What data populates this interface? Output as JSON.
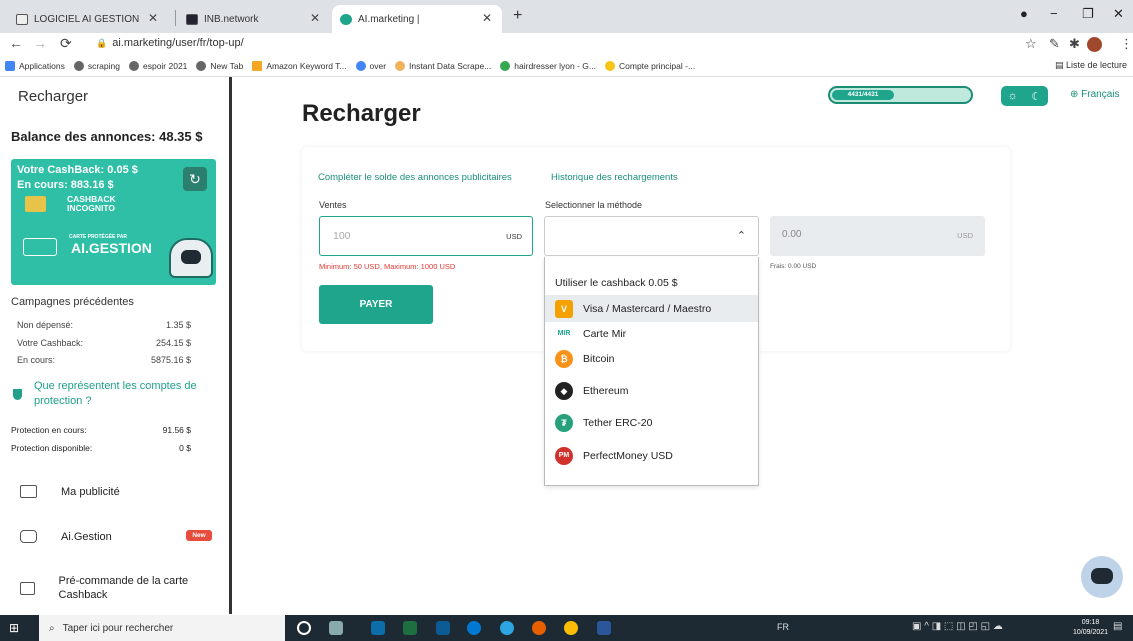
{
  "browser": {
    "tabs": [
      {
        "title": "LOGICIEL AI GESTION",
        "active": false
      },
      {
        "title": "INB.network",
        "active": false
      },
      {
        "title": "AI.marketing |",
        "active": true
      }
    ],
    "url": "ai.marketing/user/fr/top-up/",
    "bookmarks": [
      "Applications",
      "scraping",
      "espoir 2021",
      "New Tab",
      "Amazon Keyword T...",
      "over",
      "Instant Data Scrape...",
      "hairdresser lyon - G...",
      "Compte principal -..."
    ],
    "reading_list": "Liste de lecture"
  },
  "sidebar": {
    "title": "Recharger",
    "balance": "Balance des annonces: 48.35 $",
    "card": {
      "cashback": "Votre CashBack: 0.05 $",
      "en_cours": "En cours: 883.16 $",
      "incognito": "CASHBACK\nINCOGNITO",
      "protected_small": "CARTE PROTÉGÉE PAR",
      "protected_brand": "AI.GESTION"
    },
    "prev_campaigns_title": "Campagnes précédentes",
    "stats": [
      {
        "label": "Non dépensé:",
        "value": "1.35 $"
      },
      {
        "label": "Votre Cashback:",
        "value": "254.15 $"
      },
      {
        "label": "En cours:",
        "value": "5875.16 $"
      }
    ],
    "protection_question": "Que représentent les comptes de protection ?",
    "protection": [
      {
        "label": "Protection en cours:",
        "value": "91.56 $"
      },
      {
        "label": "Protection disponible:",
        "value": "0 $"
      }
    ],
    "menu": [
      {
        "label": "Ma publicité"
      },
      {
        "label": "Ai.Gestion",
        "badge": "New"
      },
      {
        "label": "Pré-commande de la carte Cashback"
      }
    ]
  },
  "main": {
    "title": "Recharger",
    "progress": {
      "label": "4431/4431",
      "fraction": 0.43
    },
    "language": "Français",
    "tabs": [
      "Compléter le solde des annonces publicitaires",
      "Historique des rechargements"
    ],
    "ventes_label": "Ventes",
    "amount_placeholder": "100",
    "currency": "USD",
    "minmax": "Minimum: 50 USD, Maximum: 1000 USD",
    "pay_button": "PAYER",
    "method_label": "Selectionner la méthode",
    "computed_amount": "0.00",
    "fees": "Frais: 0.00 USD",
    "dropdown": {
      "header": "Utiliser le cashback 0.05 $",
      "options": [
        {
          "label": "Visa / Mastercard / Maestro",
          "icon": "card-icon",
          "color": "#f4a100",
          "selected": true
        },
        {
          "label": "Carte Mir",
          "icon": "mir-icon",
          "color": "#1fa58c",
          "selected": false
        },
        {
          "label": "Bitcoin",
          "icon": "bitcoin-icon",
          "color": "#f7931a",
          "selected": false
        },
        {
          "label": "Ethereum",
          "icon": "ethereum-icon",
          "color": "#222222",
          "selected": false
        },
        {
          "label": "Tether ERC-20",
          "icon": "tether-icon",
          "color": "#26a17b",
          "selected": false
        },
        {
          "label": "PerfectMoney USD",
          "icon": "perfectmoney-icon",
          "color": "#d0312d",
          "selected": false
        }
      ]
    }
  },
  "taskbar": {
    "search_placeholder": "Taper ici pour rechercher",
    "language": "FR",
    "time": "09:18",
    "date": "10/09/2021"
  },
  "colors": {
    "accent": "#1fa58c",
    "error": "#e53935",
    "card": "#2ebfa6"
  }
}
